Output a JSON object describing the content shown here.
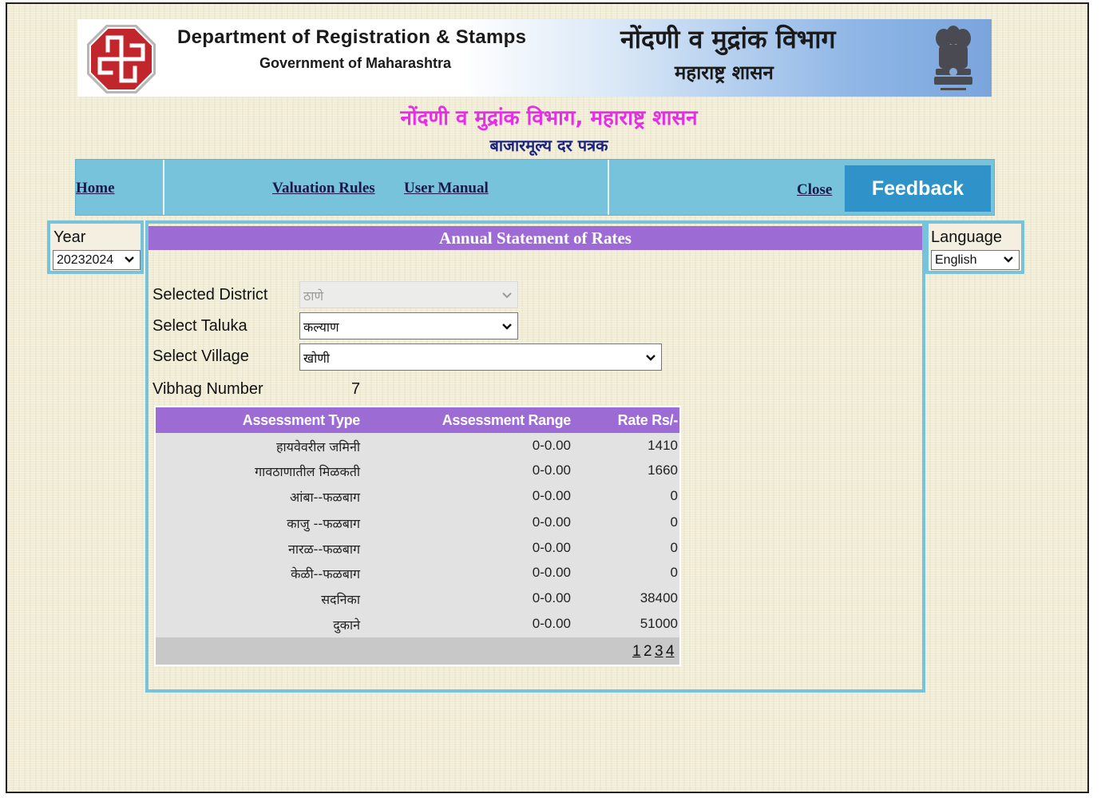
{
  "banner": {
    "dept_en": "Department of Registration & Stamps",
    "gov_en": "Government of Maharashtra",
    "dept_mr": "नोंदणी व मुद्रांक विभाग",
    "gov_mr": "महाराष्ट्र शासन",
    "logo_icon": "igr-swastik-logo-icon",
    "emblem_icon": "ashoka-emblem-icon"
  },
  "page_title_mr": "नोंदणी व मुद्रांक विभाग, महाराष्ट्र शासन",
  "page_subtitle_mr": "बाजारमूल्य दर पत्रक",
  "nav": {
    "home": "Home",
    "valuation_rules": "Valuation Rules",
    "user_manual": "User Manual",
    "close": "Close",
    "feedback": "Feedback"
  },
  "year": {
    "label": "Year",
    "selected": "20232024"
  },
  "language": {
    "label": "Language",
    "selected": "English"
  },
  "main": {
    "heading": "Annual Statement of Rates",
    "district_label": "Selected District",
    "district_value": "ठाणे",
    "taluka_label": "Select Taluka",
    "taluka_value": "कल्याण",
    "village_label": "Select Village",
    "village_value": "खोणी",
    "vibhag_label": "Vibhag Number",
    "vibhag_value": "7"
  },
  "table": {
    "headers": [
      "Assessment Type",
      "Assessment Range",
      "Rate Rs/-"
    ],
    "rows": [
      {
        "type": "हायवेवरील जमिनी",
        "range": "0-0.00",
        "rate": "1410"
      },
      {
        "type": "गावठाणातील मिळकती",
        "range": "0-0.00",
        "rate": "1660"
      },
      {
        "type": "आंबा--फळबाग",
        "range": "0-0.00",
        "rate": "0"
      },
      {
        "type": "काजु --फळबाग",
        "range": "0-0.00",
        "rate": "0"
      },
      {
        "type": "नारळ--फळबाग",
        "range": "0-0.00",
        "rate": "0"
      },
      {
        "type": "केळी--फळबाग",
        "range": "0-0.00",
        "rate": "0"
      },
      {
        "type": "सदनिका",
        "range": "0-0.00",
        "rate": "38400"
      },
      {
        "type": "दुकाने",
        "range": "0-0.00",
        "rate": "51000"
      }
    ],
    "pages": [
      "1",
      "2",
      "3",
      "4"
    ],
    "current_page": "2"
  },
  "colors": {
    "nav_bg": "#77c3dc",
    "feedback_bg": "#2f93c9",
    "header_purple": "#9d6bd4",
    "title_magenta": "#e62ee6",
    "subtitle_navy": "#1a237e"
  }
}
